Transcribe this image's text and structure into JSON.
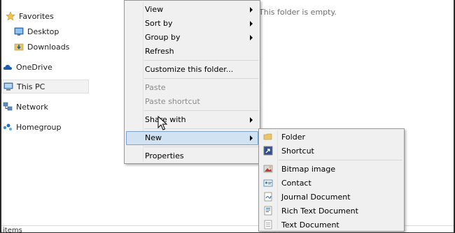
{
  "nav": {
    "favorites": "Favorites",
    "desktop": "Desktop",
    "downloads": "Downloads",
    "onedrive": "OneDrive",
    "this_pc": "This PC",
    "network": "Network",
    "homegroup": "Homegroup"
  },
  "content": {
    "empty_message": "This folder is empty.",
    "status": "items"
  },
  "context_menu": {
    "view": "View",
    "sort_by": "Sort by",
    "group_by": "Group by",
    "refresh": "Refresh",
    "customize": "Customize this folder...",
    "paste": "Paste",
    "paste_shortcut": "Paste shortcut",
    "share_with": "Share with",
    "new": "New",
    "properties": "Properties"
  },
  "new_submenu": {
    "folder": "Folder",
    "shortcut": "Shortcut",
    "bitmap": "Bitmap image",
    "contact": "Contact",
    "journal": "Journal Document",
    "rich_text": "Rich Text Document",
    "text": "Text Document"
  },
  "colors": {
    "highlight_bg": "#d1e2f2",
    "highlight_border": "#7da2ce",
    "menu_bg": "#f0f0f0",
    "disabled_text": "#8b8b8b"
  }
}
